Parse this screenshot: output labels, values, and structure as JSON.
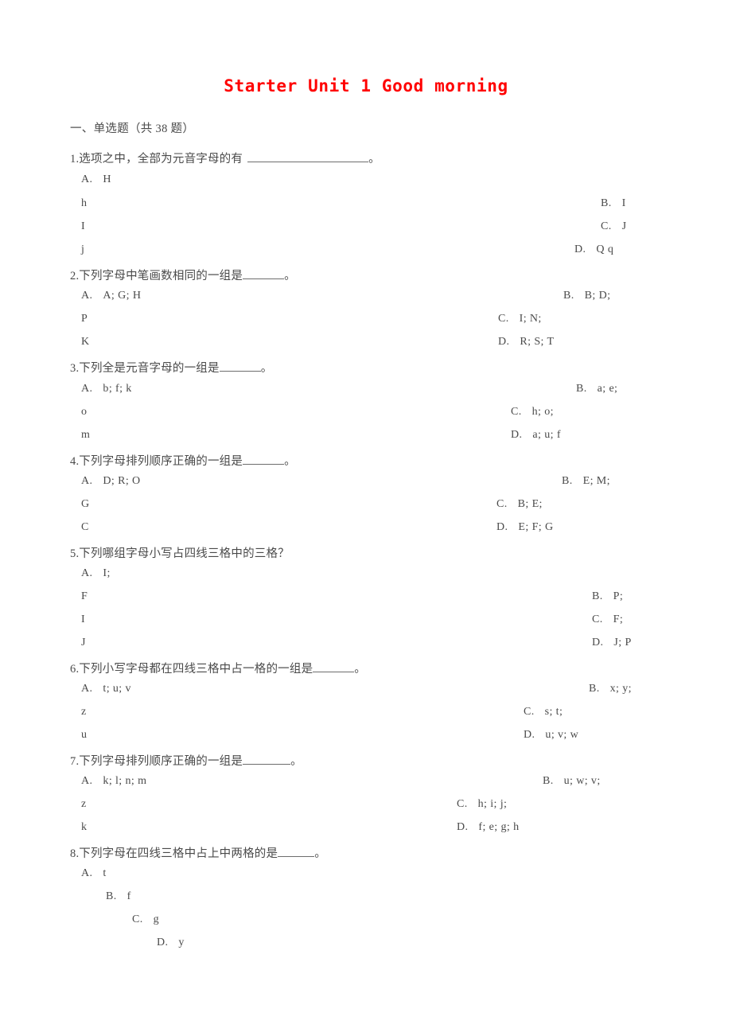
{
  "document": {
    "title": "Starter Unit 1 Good morning",
    "title_color": "#ff0000",
    "section_heading": "一、单选题（共 38 题）"
  },
  "punctuation": {
    "period_cn": "。"
  },
  "questions": [
    {
      "number": "1.",
      "stem_before_blank": "1.选项之中，全部为元音字母的有",
      "stem_after_blank": "。",
      "options_left": [
        {
          "label": "A.",
          "text": "H"
        },
        {
          "label": "",
          "text": "h"
        },
        {
          "label": "",
          "text": "I"
        },
        {
          "label": "",
          "text": "j"
        }
      ],
      "options_right": [
        {
          "label": "B.",
          "text": "I"
        },
        {
          "label": "C.",
          "text": "J"
        },
        {
          "label": "D.",
          "text": "Q q"
        }
      ]
    },
    {
      "number": "2.",
      "stem_before_blank": "2.下列字母中笔画数相同的一组是",
      "stem_after_blank": "。",
      "options_left": [
        {
          "label": "A.",
          "text": "A; G; H"
        },
        {
          "label": "",
          "text": "P"
        },
        {
          "label": "",
          "text": "K"
        }
      ],
      "options_right": [
        {
          "label": "B.",
          "text": "B; D;"
        },
        {
          "label": "C.",
          "text": "I; N;"
        },
        {
          "label": "D.",
          "text": "R; S; T"
        }
      ]
    },
    {
      "number": "3.",
      "stem_before_blank": "3.下列全是元音字母的一组是",
      "stem_after_blank": "。",
      "options_left": [
        {
          "label": "A.",
          "text": "b; f; k"
        },
        {
          "label": "",
          "text": "o"
        },
        {
          "label": "",
          "text": "m"
        }
      ],
      "options_right": [
        {
          "label": "B.",
          "text": "a; e;"
        },
        {
          "label": "C.",
          "text": "h; o;"
        },
        {
          "label": "D.",
          "text": "a; u; f"
        }
      ]
    },
    {
      "number": "4.",
      "stem_before_blank": "4.下列字母排列顺序正确的一组是",
      "stem_after_blank": "。",
      "options_left": [
        {
          "label": "A.",
          "text": "D; R; O"
        },
        {
          "label": "",
          "text": "G"
        },
        {
          "label": "",
          "text": "C"
        }
      ],
      "options_right": [
        {
          "label": "B.",
          "text": "E; M;"
        },
        {
          "label": "C.",
          "text": "B; E;"
        },
        {
          "label": "D.",
          "text": "E; F; G"
        }
      ]
    },
    {
      "number": "5.",
      "stem_before_blank": "5.下列哪组字母小写占四线三格中的三格？",
      "stem_after_blank": "",
      "options_left": [
        {
          "label": "A.",
          "text": "I;"
        },
        {
          "label": "",
          "text": "F"
        },
        {
          "label": "",
          "text": "I"
        },
        {
          "label": "",
          "text": "J"
        }
      ],
      "options_right": [
        {
          "label": "B.",
          "text": "P;"
        },
        {
          "label": "C.",
          "text": "F;"
        },
        {
          "label": "D.",
          "text": "J; P"
        }
      ]
    },
    {
      "number": "6.",
      "stem_before_blank": "6.下列小写字母都在四线三格中占一格的一组是",
      "stem_after_blank": "。",
      "options_left": [
        {
          "label": "A.",
          "text": "t; u; v"
        },
        {
          "label": "",
          "text": "z"
        },
        {
          "label": "",
          "text": "u"
        }
      ],
      "options_right": [
        {
          "label": "B.",
          "text": "x; y;"
        },
        {
          "label": "C.",
          "text": "s; t;"
        },
        {
          "label": "D.",
          "text": "u; v; w"
        }
      ]
    },
    {
      "number": "7.",
      "stem_before_blank": "7.下列字母排列顺序正确的一组是",
      "stem_after_blank": "。",
      "options_left": [
        {
          "label": "A.",
          "text": "k; l; n; m"
        },
        {
          "label": "",
          "text": "z"
        },
        {
          "label": "",
          "text": "k"
        }
      ],
      "options_right": [
        {
          "label": "B.",
          "text": "u; w; v;"
        },
        {
          "label": "C.",
          "text": "h; i; j;"
        },
        {
          "label": "D.",
          "text": "f; e; g; h"
        }
      ]
    },
    {
      "number": "8.",
      "stem_before_blank": "8.下列字母在四线三格中占上中两格的是",
      "stem_after_blank": "。",
      "options_staircase": [
        {
          "label": "A.",
          "text": "t"
        },
        {
          "label": "B.",
          "text": "f"
        },
        {
          "label": "C.",
          "text": "g"
        },
        {
          "label": "D.",
          "text": "y"
        }
      ]
    }
  ]
}
